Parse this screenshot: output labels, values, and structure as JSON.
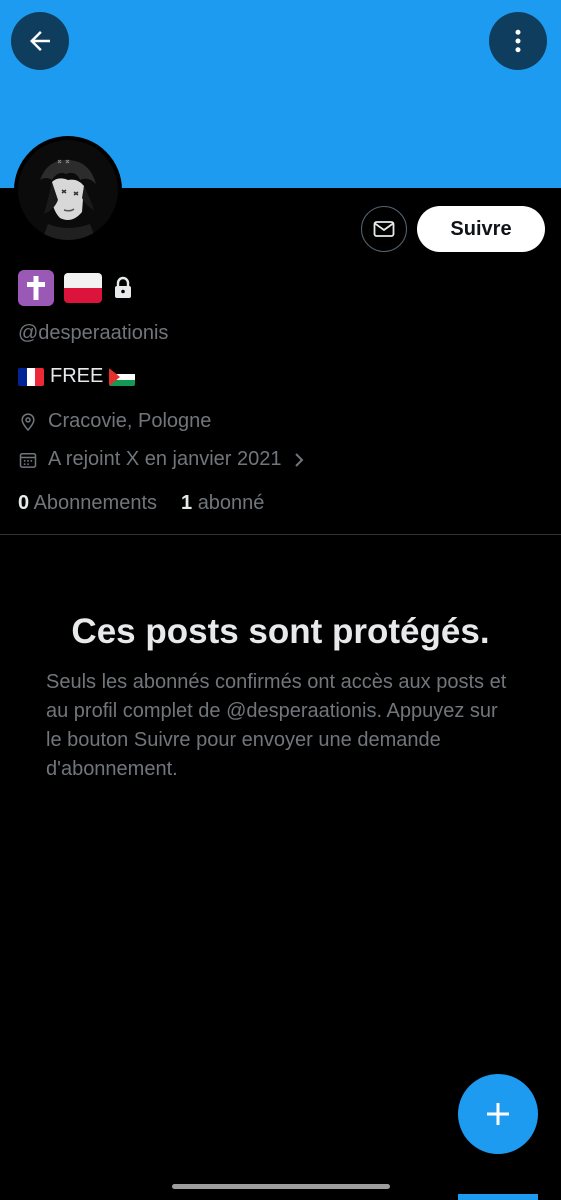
{
  "header": {
    "back_icon": "arrow-left-icon",
    "more_icon": "more-vertical-icon",
    "banner_color": "#1d9bf0"
  },
  "profile": {
    "name_emojis": [
      "latin-cross-emoji",
      "poland-flag-emoji"
    ],
    "protected_icon": "lock-icon",
    "handle": "@desperaationis",
    "bio_text": "FREE",
    "bio_emojis": [
      "france-flag-emoji",
      "palestine-flag-emoji"
    ],
    "location": "Cracovie, Pologne",
    "joined": "A rejoint X en janvier 2021",
    "following_count": "0",
    "following_label": "Abonnements",
    "followers_count": "1",
    "followers_label": "abonné"
  },
  "actions": {
    "message_icon": "envelope-icon",
    "follow_label": "Suivre"
  },
  "protected": {
    "title": "Ces posts sont protégés.",
    "description": "Seuls les abonnés confirmés ont accès aux posts et au profil complet de @desperaationis. Appuyez sur le bouton Suivre pour envoyer une demande d'abonnement."
  },
  "fab": {
    "icon": "plus-icon"
  },
  "colors": {
    "accent": "#1d9bf0",
    "background": "#000000",
    "muted": "#71767b"
  }
}
